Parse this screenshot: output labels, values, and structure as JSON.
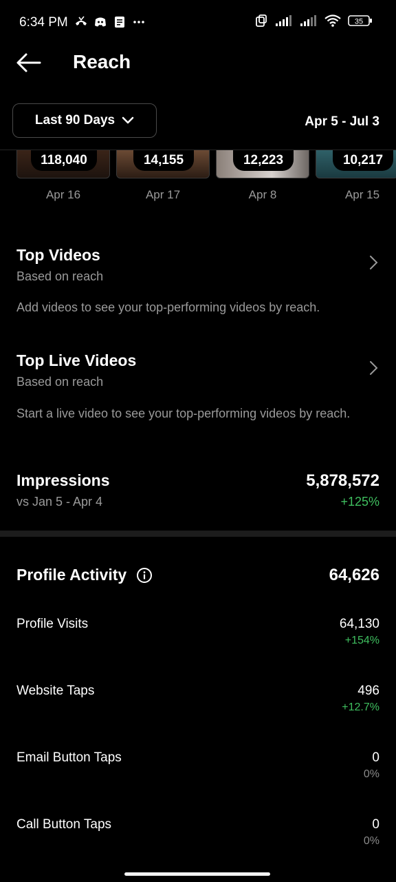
{
  "status_bar": {
    "time": "6:34 PM",
    "battery": "35",
    "icons_left": [
      "missed-call-icon",
      "discord-icon",
      "notes-icon",
      "more-dots-icon"
    ],
    "icons_right": [
      "screen-mirror-icon",
      "signal-icon",
      "signal-icon",
      "wifi-icon",
      "battery-icon"
    ]
  },
  "header": {
    "title": "Reach",
    "back_icon": "arrow-left-icon"
  },
  "filter": {
    "range_label": "Last 90 Days",
    "date_range": "Apr 5 - Jul 3"
  },
  "top_content": [
    {
      "count": "118,040",
      "date": "Apr 16"
    },
    {
      "count": "14,155",
      "date": "Apr 17"
    },
    {
      "count": "12,223",
      "date": "Apr 8"
    },
    {
      "count": "10,217",
      "date": "Apr 15"
    }
  ],
  "top_videos": {
    "title": "Top Videos",
    "subtitle": "Based on reach",
    "description": "Add videos to see your top-performing videos by reach."
  },
  "top_live_videos": {
    "title": "Top Live Videos",
    "subtitle": "Based on reach",
    "description": "Start a live video to see your top-performing videos by reach."
  },
  "impressions": {
    "title": "Impressions",
    "comparison": "vs Jan 5 - Apr 4",
    "value": "5,878,572",
    "change": "+125%"
  },
  "profile_activity": {
    "title": "Profile Activity",
    "total": "64,626",
    "rows": [
      {
        "label": "Profile Visits",
        "value": "64,130",
        "change": "+154%",
        "positive": true
      },
      {
        "label": "Website Taps",
        "value": "496",
        "change": "+12.7%",
        "positive": true
      },
      {
        "label": "Email Button Taps",
        "value": "0",
        "change": "0%",
        "positive": false
      },
      {
        "label": "Call Button Taps",
        "value": "0",
        "change": "0%",
        "positive": false
      }
    ]
  },
  "colors": {
    "positive": "#3fbf5f",
    "muted": "#9a9a9a",
    "background": "#000000"
  }
}
